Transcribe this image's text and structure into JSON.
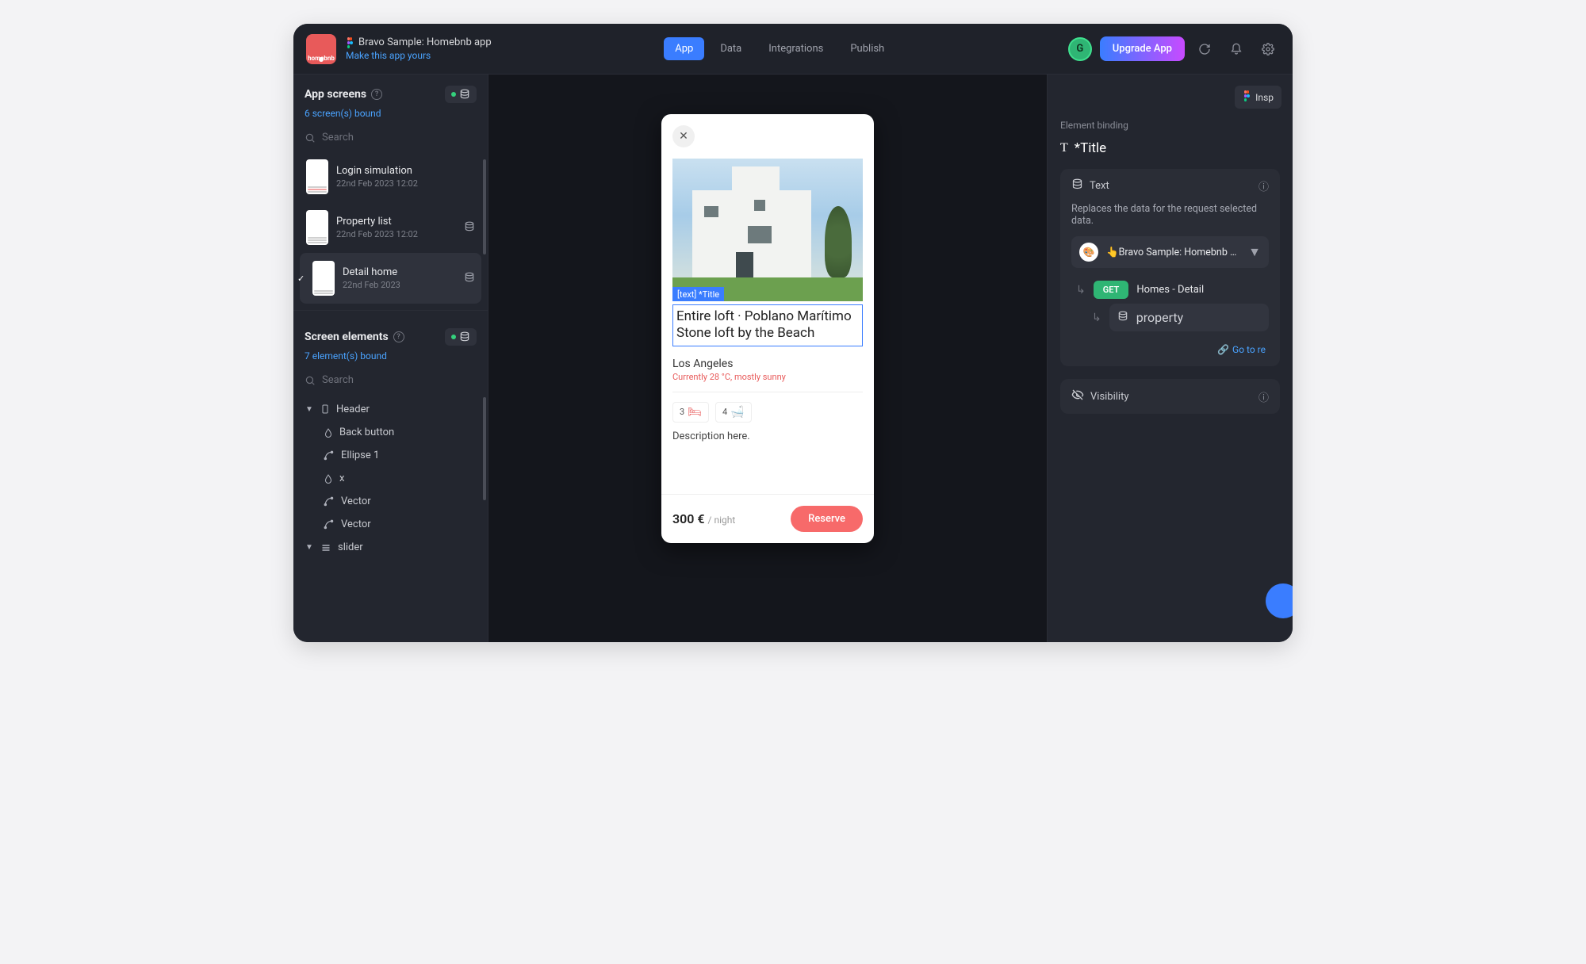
{
  "header": {
    "appIconText": "homebnb",
    "title": "Bravo Sample: Homebnb app",
    "subLink": "Make this app yours",
    "tabs": [
      "App",
      "Data",
      "Integrations",
      "Publish"
    ],
    "activeTab": "App",
    "avatarLetter": "G",
    "upgrade": "Upgrade App"
  },
  "left": {
    "screensTitle": "App screens",
    "screensBound": "6 screen(s) bound",
    "searchPlaceholder": "Search",
    "screens": [
      {
        "name": "Login simulation",
        "date": "22nd Feb 2023 12:02",
        "hasDb": false,
        "active": false
      },
      {
        "name": "Property list",
        "date": "22nd Feb 2023 12:02",
        "hasDb": true,
        "active": false
      },
      {
        "name": "Detail home",
        "date": "22nd Feb 2023",
        "hasDb": true,
        "active": true
      }
    ],
    "elementsTitle": "Screen elements",
    "elementsBound": "7 element(s) bound",
    "elements": [
      {
        "label": "Header",
        "iconType": "device",
        "expandable": true,
        "expanded": true,
        "indent": 0
      },
      {
        "label": "Back button",
        "iconType": "drop",
        "indent": 1
      },
      {
        "label": "Ellipse 1",
        "iconType": "vector",
        "indent": 1
      },
      {
        "label": "x",
        "iconType": "drop",
        "indent": 1
      },
      {
        "label": "Vector",
        "iconType": "vector",
        "indent": 1
      },
      {
        "label": "Vector",
        "iconType": "vector",
        "indent": 1
      },
      {
        "label": "slider",
        "iconType": "list",
        "expandable": true,
        "expanded": true,
        "indent": 0
      }
    ]
  },
  "phone": {
    "tagLabel": "[text] *Title",
    "title": "Entire loft · Poblano Marítimo Stone loft by the Beach",
    "city": "Los Angeles",
    "weather": "Currently 28 °C, mostly sunny",
    "beds": "3",
    "baths": "4",
    "description": "Description here.",
    "price": "300 €",
    "per": "/ night",
    "reserve": "Reserve"
  },
  "right": {
    "inspect": "Insp",
    "bindingLabel": "Element binding",
    "bindingTitle": "*Title",
    "textGroupLabel": "Text",
    "replacesDesc": "Replaces the data for the request selected data.",
    "collectionName": "Bravo Sample: Homebnb app (...",
    "method": "GET",
    "requestName": "Homes - Detail",
    "propertyLabel": "property",
    "gotoLabel": "Go to re",
    "visibilityLabel": "Visibility"
  }
}
